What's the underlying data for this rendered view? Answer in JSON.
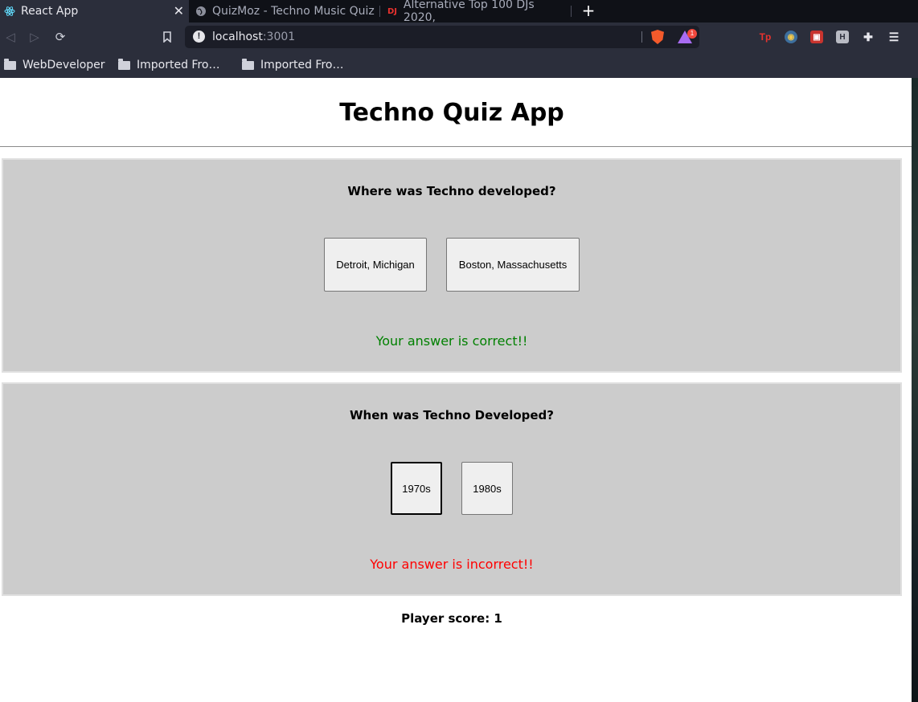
{
  "browser": {
    "tabs": [
      {
        "title": "React App",
        "active": true,
        "icon": "react-icon"
      },
      {
        "title": "QuizMoz - Techno Music Quiz",
        "active": false,
        "icon": "globe-icon"
      },
      {
        "title": "Alternative Top 100 DJs 2020,",
        "active": false,
        "icon": "dj-icon"
      }
    ],
    "url": {
      "host": "localhost",
      "port": ":3001"
    },
    "rewards_badge": "1",
    "bookmarks": [
      {
        "label": "WebDeveloper"
      },
      {
        "label": "Imported Fro…"
      },
      {
        "label": "Imported Fro…"
      }
    ]
  },
  "app": {
    "title": "Techno Quiz App",
    "questions": [
      {
        "question": "Where was Techno developed?",
        "answers": [
          "Detroit, Michigan",
          "Boston, Massachusetts"
        ],
        "feedback": "Your answer is correct!!",
        "feedback_color": "#008000"
      },
      {
        "question": "When was Techno Developed?",
        "answers": [
          "1970s",
          "1980s"
        ],
        "feedback": "Your answer is incorrect!!",
        "feedback_color": "#ff0000"
      }
    ],
    "score_text": "Player score: 1"
  },
  "colors": {
    "card_background": "#cccccc",
    "correct": "#008000",
    "incorrect": "#ff0000"
  }
}
